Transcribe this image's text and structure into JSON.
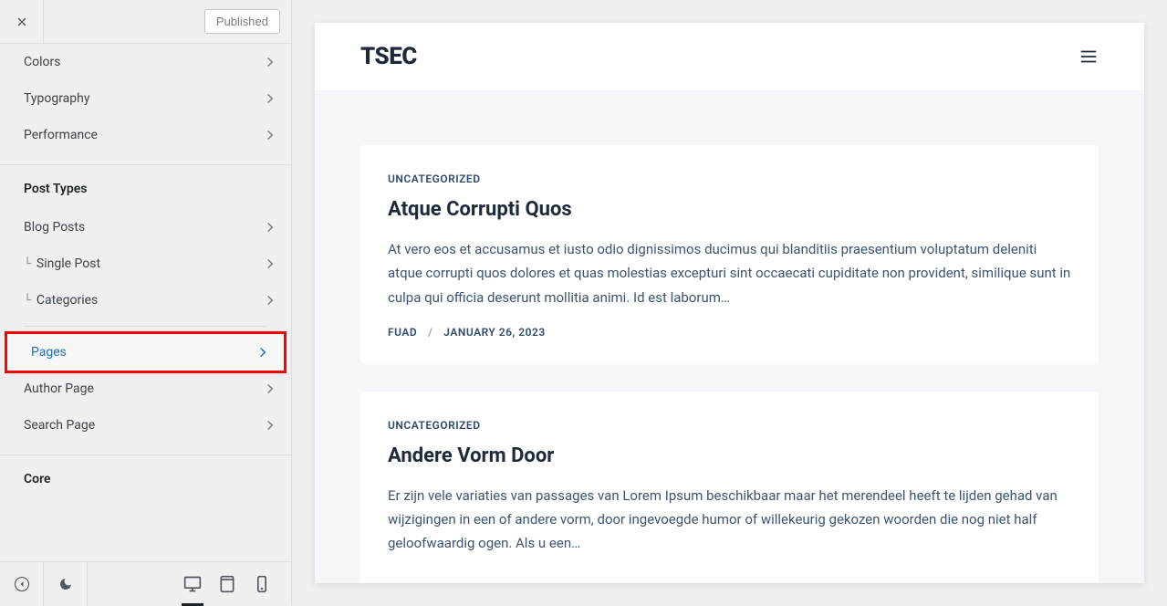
{
  "header": {
    "published_label": "Published"
  },
  "menu_top": [
    {
      "label": "Colors"
    },
    {
      "label": "Typography"
    },
    {
      "label": "Performance"
    }
  ],
  "section_post_types": "Post Types",
  "menu_post_types": [
    {
      "label": "Blog Posts",
      "sub": false
    },
    {
      "label": "Single Post",
      "sub": true
    },
    {
      "label": "Categories",
      "sub": true
    }
  ],
  "menu_post_types2": [
    {
      "label": "Pages",
      "active": true
    },
    {
      "label": "Author Page"
    },
    {
      "label": "Search Page"
    }
  ],
  "section_core": "Core",
  "preview": {
    "site_title": "TSEC",
    "posts": [
      {
        "category": "UNCATEGORIZED",
        "title": "Atque Corrupti Quos",
        "excerpt": "At vero eos et accusamus et iusto odio dignissimos ducimus qui blanditiis praesentium voluptatum deleniti atque corrupti quos dolores et quas molestias excepturi sint occaecati cupiditate non provident, similique sunt in culpa qui officia deserunt mollitia animi. Id est laborum…",
        "author": "FUAD",
        "date": "JANUARY 26, 2023"
      },
      {
        "category": "UNCATEGORIZED",
        "title": "Andere Vorm Door",
        "excerpt": "Er zijn vele variaties van passages van Lorem Ipsum beschikbaar maar het merendeel heeft te lijden gehad van wijzigingen in een of andere vorm, door ingevoegde humor of willekeurig gekozen woorden die nog niet half geloofwaardig ogen. Als u een…",
        "author": "",
        "date": ""
      }
    ]
  }
}
